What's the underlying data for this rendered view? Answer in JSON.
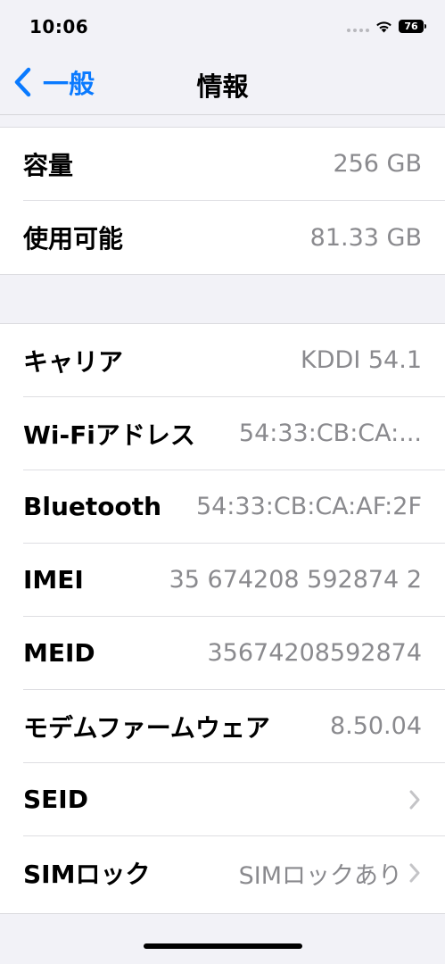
{
  "status": {
    "time": "10:06",
    "battery": "76"
  },
  "nav": {
    "back_label": "一般",
    "title": "情報"
  },
  "groups": [
    {
      "rows": [
        {
          "label": "容量",
          "value": "256 GB"
        },
        {
          "label": "使用可能",
          "value": "81.33 GB"
        }
      ]
    },
    {
      "rows": [
        {
          "label": "キャリア",
          "value": "KDDI 54.1"
        },
        {
          "label": "Wi-Fiアドレス",
          "value": "54:33:CB:CA:..."
        },
        {
          "label": "Bluetooth",
          "value": "54:33:CB:CA:AF:2F"
        },
        {
          "label": "IMEI",
          "value": "35 674208 592874 2"
        },
        {
          "label": "MEID",
          "value": "35674208592874"
        },
        {
          "label": "モデムファームウェア",
          "value": "8.50.04"
        },
        {
          "label": "SEID",
          "value": ""
        },
        {
          "label": "SIMロック",
          "value": "SIMロックあり"
        }
      ]
    }
  ],
  "colors": {
    "accent": "#0a7aff",
    "background": "#f2f2f7",
    "secondary_text": "#8a8a8e"
  },
  "icons": {
    "back": "chevron-left-icon",
    "disclosure": "chevron-right-icon",
    "wifi": "wifi-icon",
    "signal": "cellular-signal-icon",
    "battery": "battery-icon"
  }
}
